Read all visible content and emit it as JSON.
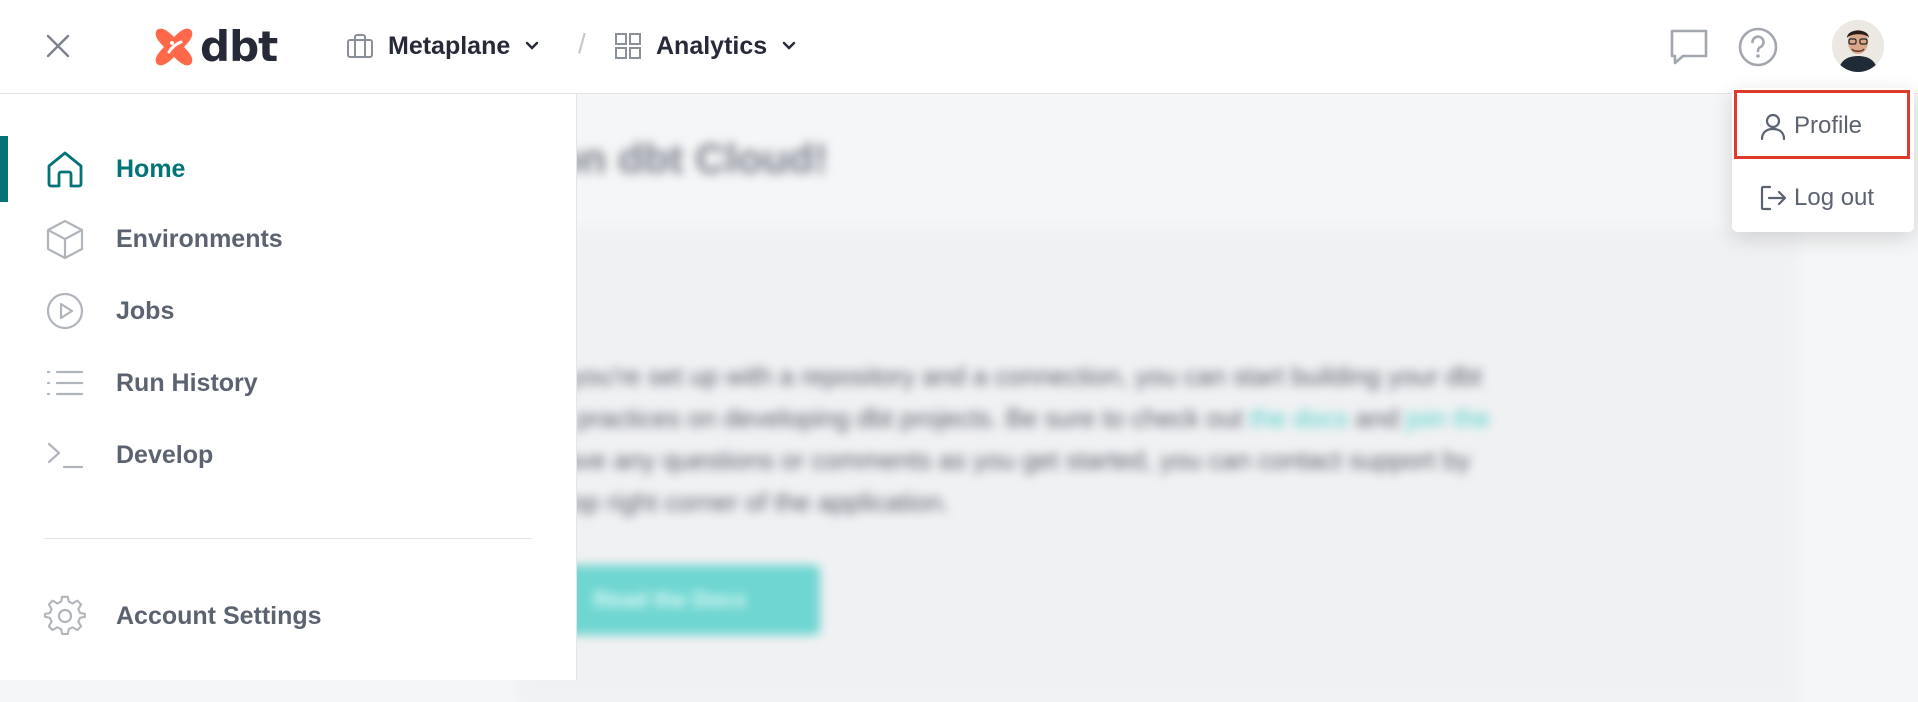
{
  "header": {
    "logo_text": "dbt",
    "account": {
      "label": "Metaplane",
      "icon": "briefcase-icon"
    },
    "separator": "/",
    "project": {
      "label": "Analytics",
      "icon": "grid-icon"
    },
    "icons": [
      "close-icon",
      "chat-icon",
      "help-icon",
      "avatar"
    ]
  },
  "sidebar": {
    "items": [
      {
        "label": "Home",
        "icon": "home-icon",
        "active": true
      },
      {
        "label": "Environments",
        "icon": "cube-icon"
      },
      {
        "label": "Jobs",
        "icon": "play-circle-icon"
      },
      {
        "label": "Run History",
        "icon": "list-icon"
      },
      {
        "label": "Develop",
        "icon": "terminal-icon"
      }
    ],
    "settings": {
      "label": "Account Settings",
      "icon": "gear-icon"
    }
  },
  "user_menu": {
    "items": [
      {
        "label": "Profile",
        "icon": "user-icon",
        "highlighted": true
      },
      {
        "label": "Log out",
        "icon": "logout-icon"
      }
    ]
  },
  "background": {
    "title": "e on dbt Cloud!",
    "paragraph_1": "that you're set up with a repository and a connection, you can start building your dbt",
    "paragraph_2": "best practices on developing dbt projects. Be sure to check out",
    "link_1": "the docs",
    "paragraph_3": "and",
    "link_2": "join the",
    "paragraph_4": "y. Have any questions or comments as you get started, you can contact support by",
    "paragraph_5": "the top right corner of the application.",
    "button_label": "Read the Docs"
  },
  "colors": {
    "accent": "#047377",
    "logo": "#ff694a",
    "highlight_box": "#e03a2c"
  }
}
